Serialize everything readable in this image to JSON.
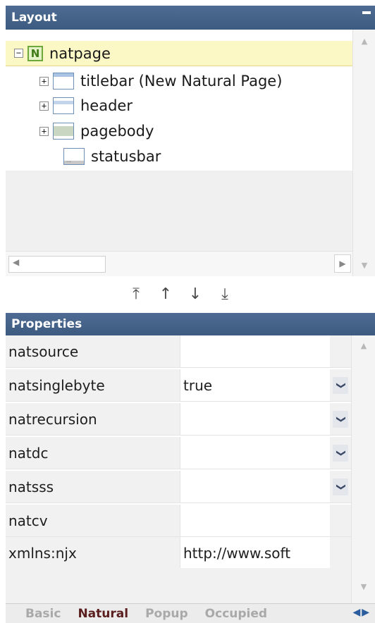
{
  "layout_panel": {
    "title": "Layout",
    "tree": {
      "root": {
        "label": "natpage",
        "icon": "natural-page-icon",
        "expander": "−"
      },
      "children": [
        {
          "label": "titlebar (New Natural Page)",
          "icon": "titlebar-icon",
          "expander": "+"
        },
        {
          "label": "header",
          "icon": "header-icon",
          "expander": "+"
        },
        {
          "label": "pagebody",
          "icon": "pagebody-icon",
          "expander": "+"
        },
        {
          "label": "statusbar",
          "icon": "statusbar-icon",
          "expander": ""
        }
      ]
    }
  },
  "move_toolbar": {
    "buttons": [
      {
        "icon": "move-to-top-icon",
        "glyph": "⤒"
      },
      {
        "icon": "move-up-icon",
        "glyph": "↑"
      },
      {
        "icon": "move-down-icon",
        "glyph": "↓"
      },
      {
        "icon": "move-to-bottom-icon",
        "glyph": "⤓"
      }
    ]
  },
  "properties_panel": {
    "title": "Properties",
    "rows": [
      {
        "name": "natsource",
        "value": "",
        "has_dropdown": false
      },
      {
        "name": "natsinglebyte",
        "value": "true",
        "has_dropdown": true
      },
      {
        "name": "natrecursion",
        "value": "",
        "has_dropdown": true
      },
      {
        "name": "natdc",
        "value": "",
        "has_dropdown": true
      },
      {
        "name": "natsss",
        "value": "",
        "has_dropdown": true
      },
      {
        "name": "natcv",
        "value": "",
        "has_dropdown": false
      },
      {
        "name": "xmlns:njx",
        "value": "http://www.soft",
        "has_dropdown": false
      }
    ]
  },
  "tabs": {
    "items": [
      "Basic",
      "Natural",
      "Popup",
      "Occupied"
    ],
    "active": "Natural",
    "nav_prev": "◀",
    "nav_next": "▶"
  },
  "colors": {
    "header_bar": "#3d5a80",
    "selected_row": "#fbf8c6",
    "active_tab": "#5a1e1e"
  }
}
